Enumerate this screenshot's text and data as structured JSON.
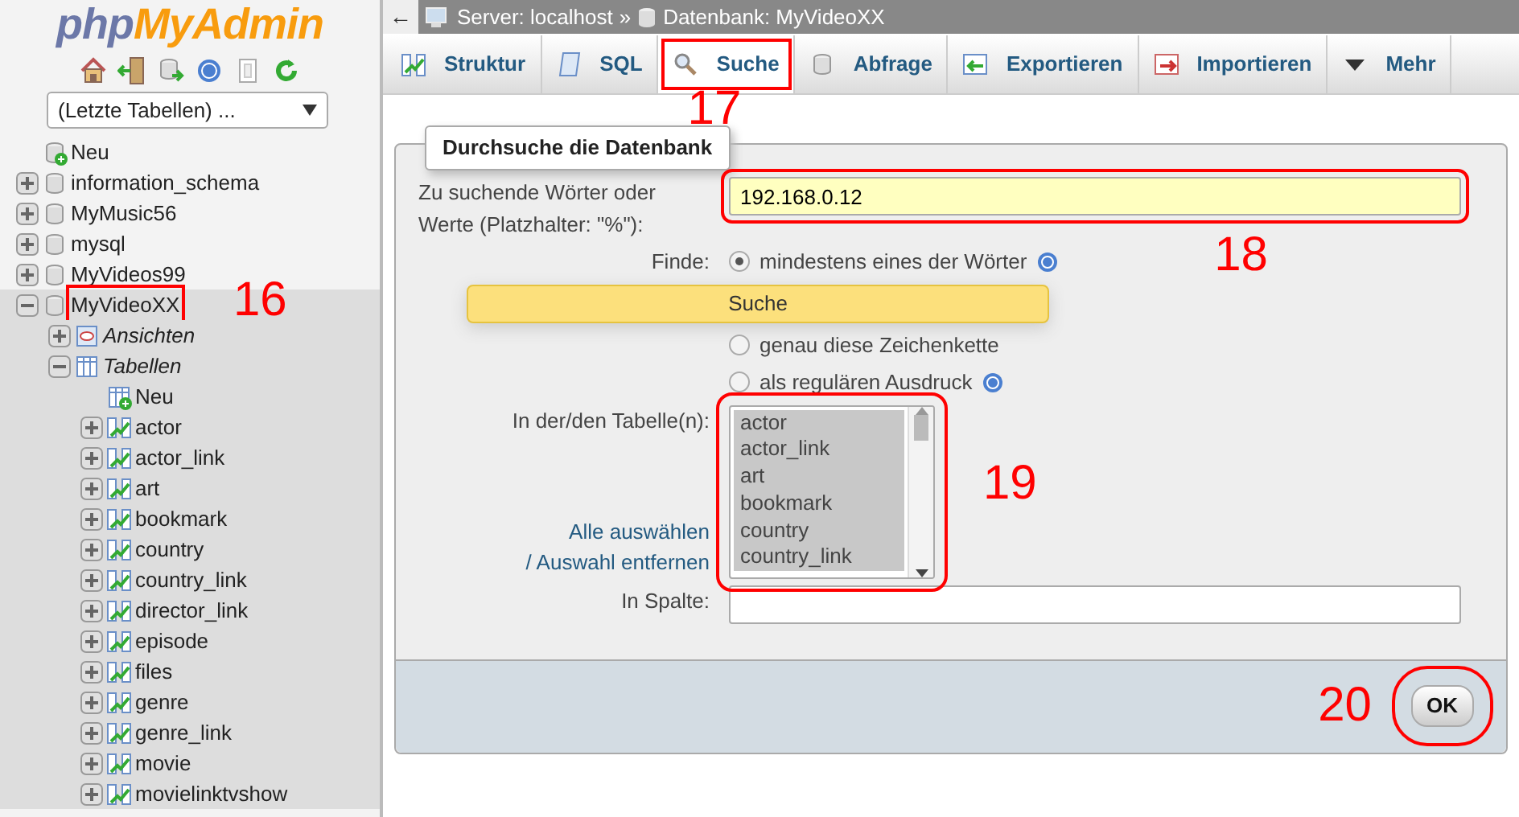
{
  "sidebar": {
    "logo": {
      "prefix": "php",
      "name": "MyAdmin"
    },
    "recent_tables": {
      "value": "(Letzte Tabellen) ..."
    },
    "tree": [
      {
        "label": "Neu",
        "kind": "new",
        "selected": false
      },
      {
        "label": "information_schema",
        "kind": "database",
        "expanded": false,
        "selected": false
      },
      {
        "label": "MyMusic56",
        "kind": "database",
        "expanded": false,
        "selected": false
      },
      {
        "label": "mysql",
        "kind": "database",
        "expanded": false,
        "selected": false
      },
      {
        "label": "MyVideos99",
        "kind": "database",
        "expanded": false,
        "selected": false
      },
      {
        "label": "MyVideoXX",
        "kind": "database",
        "expanded": true,
        "selected": true,
        "annotation": "16",
        "children": [
          {
            "label": "Ansichten",
            "kind": "views",
            "expanded": false
          },
          {
            "label": "Tabellen",
            "kind": "tables",
            "expanded": true,
            "children": [
              {
                "label": "Neu",
                "kind": "new_table"
              },
              {
                "label": "actor",
                "kind": "table",
                "expanded": false
              },
              {
                "label": "actor_link",
                "kind": "table",
                "expanded": false
              },
              {
                "label": "art",
                "kind": "table",
                "expanded": false
              },
              {
                "label": "bookmark",
                "kind": "table",
                "expanded": false
              },
              {
                "label": "country",
                "kind": "table",
                "expanded": false
              },
              {
                "label": "country_link",
                "kind": "table",
                "expanded": false
              },
              {
                "label": "director_link",
                "kind": "table",
                "expanded": false
              },
              {
                "label": "episode",
                "kind": "table",
                "expanded": false
              },
              {
                "label": "files",
                "kind": "table",
                "expanded": false
              },
              {
                "label": "genre",
                "kind": "table",
                "expanded": false
              },
              {
                "label": "genre_link",
                "kind": "table",
                "expanded": false
              },
              {
                "label": "movie",
                "kind": "table",
                "expanded": false
              },
              {
                "label": "movielinktvshow",
                "kind": "table",
                "expanded": false
              }
            ]
          }
        ]
      }
    ]
  },
  "breadcrumb": {
    "back": "←",
    "server": "Server: localhost",
    "separator": "»",
    "database": "Datenbank: MyVideoXX"
  },
  "tabs": [
    {
      "label": "Struktur",
      "kind": "structure",
      "selected": false
    },
    {
      "label": "SQL",
      "kind": "sql",
      "selected": false
    },
    {
      "label": "Suche",
      "kind": "search",
      "selected": true,
      "annotation": "17"
    },
    {
      "label": "Abfrage",
      "kind": "query",
      "selected": false
    },
    {
      "label": "Exportieren",
      "kind": "export",
      "selected": false
    },
    {
      "label": "Importieren",
      "kind": "import",
      "selected": false
    },
    {
      "label": "Mehr",
      "kind": "more",
      "selected": false
    }
  ],
  "form": {
    "legend": "Durchsuche die Datenbank",
    "search_label": "Zu suchende Wörter oder Werte (Platzhalter: \"%\"):",
    "search_value": "192.168.0.12",
    "search_annotation": "18",
    "find_label": "Finde:",
    "autocomplete": "Suche",
    "find_options": [
      {
        "label": "mindestens eines der Wörter",
        "selected": true,
        "help": true
      },
      {
        "label": "genau diese Zeichenkette",
        "selected": false,
        "help": false
      },
      {
        "label": "als regulären Ausdruck",
        "selected": false,
        "help": true
      }
    ],
    "tables_label": "In der/den Tabelle(n):",
    "tables_annotation": "19",
    "tables": [
      {
        "label": "actor",
        "selected": true
      },
      {
        "label": "actor_link",
        "selected": true
      },
      {
        "label": "art",
        "selected": true
      },
      {
        "label": "bookmark",
        "selected": true
      },
      {
        "label": "country",
        "selected": true
      },
      {
        "label": "country_link",
        "selected": true
      }
    ],
    "select_all": "Alle auswählen",
    "deselect": "/ Auswahl entfernen",
    "column_label": "In Spalte:",
    "submit": "OK",
    "submit_annotation": "20"
  }
}
